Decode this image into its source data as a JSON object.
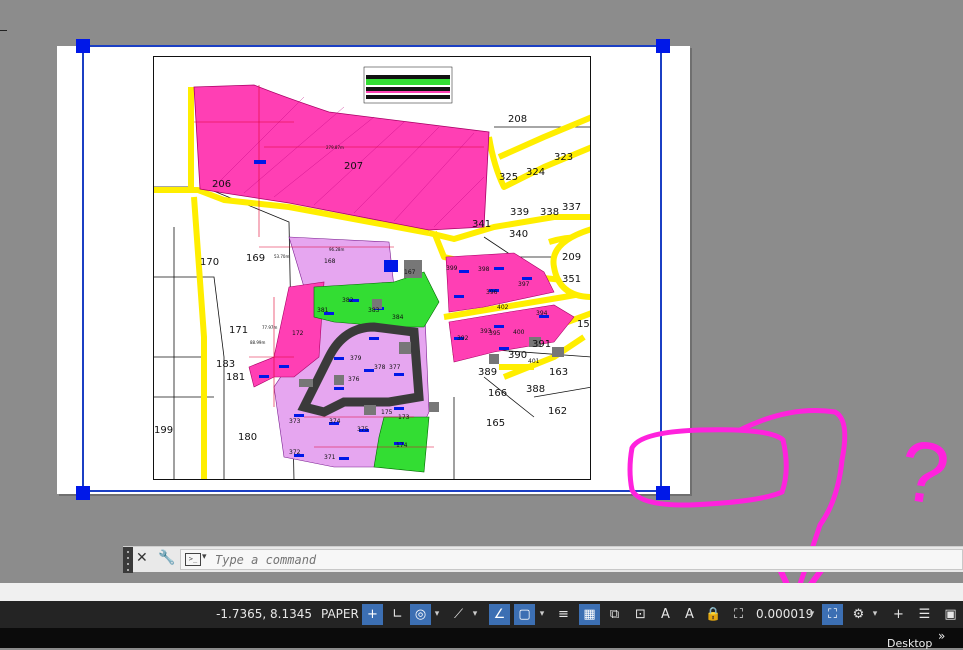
{
  "colors": {
    "canvas_bg": "#8c8c8c",
    "viewport_border": "#1b3fc4",
    "grip": "#0018e8",
    "parcel_pink": "#ff3fb4",
    "parcel_green": "#33dd33",
    "parcel_lavender": "#e6a6f0",
    "road_yellow": "#ffee00",
    "annotation_magenta": "#ff22dd",
    "status_bg": "#242424",
    "toggle_on": "#3c6fb3"
  },
  "map": {
    "parcel_labels": [
      "208",
      "207",
      "206",
      "325",
      "324",
      "323",
      "341",
      "339",
      "338",
      "337",
      "340",
      "209",
      "351",
      "170",
      "169",
      "168",
      "167",
      "399",
      "398",
      "397",
      "382",
      "383",
      "381",
      "384",
      "396",
      "395",
      "402",
      "394",
      "171",
      "172",
      "158",
      "392",
      "393",
      "400",
      "391",
      "390",
      "401",
      "163",
      "183",
      "181",
      "180",
      "379",
      "378",
      "377",
      "376",
      "389",
      "388",
      "166",
      "162",
      "373",
      "374",
      "375",
      "175",
      "165",
      "199",
      "174",
      "372",
      "371",
      "173"
    ],
    "dimension_labels": [
      "279.87m",
      "96.28m",
      "53.70m",
      "77.97m",
      "88.99m"
    ]
  },
  "annotation": {
    "question_mark": "?"
  },
  "command_line": {
    "close_icon": "close-icon",
    "customize_icon": "wrench-icon",
    "prompt_icon": "command-prompt-icon",
    "placeholder": "Type a command"
  },
  "status_bar": {
    "coordinates": "-1.7365, 8.1345",
    "space_label": "PAPER",
    "annotation_scale": "0.000019",
    "icons": [
      "infer-constraints-icon",
      "ortho-icon",
      "polar-tracking-icon",
      "object-snap-tracking-icon",
      "dynamic-ucs-icon",
      "object-snap-icon",
      "lineweight-icon",
      "transparency-icon",
      "selection-cycling-icon",
      "3d-osnap-icon",
      "annotation-visibility-icon",
      "auto-scale-icon",
      "lock-ui-icon",
      "isolate-objects-icon",
      "hardware-acceleration-icon",
      "workspace-gear-icon",
      "quick-properties-icon",
      "clean-screen-icon"
    ]
  },
  "taskbar": {
    "desktop_label": "Desktop",
    "chevron": "»"
  }
}
